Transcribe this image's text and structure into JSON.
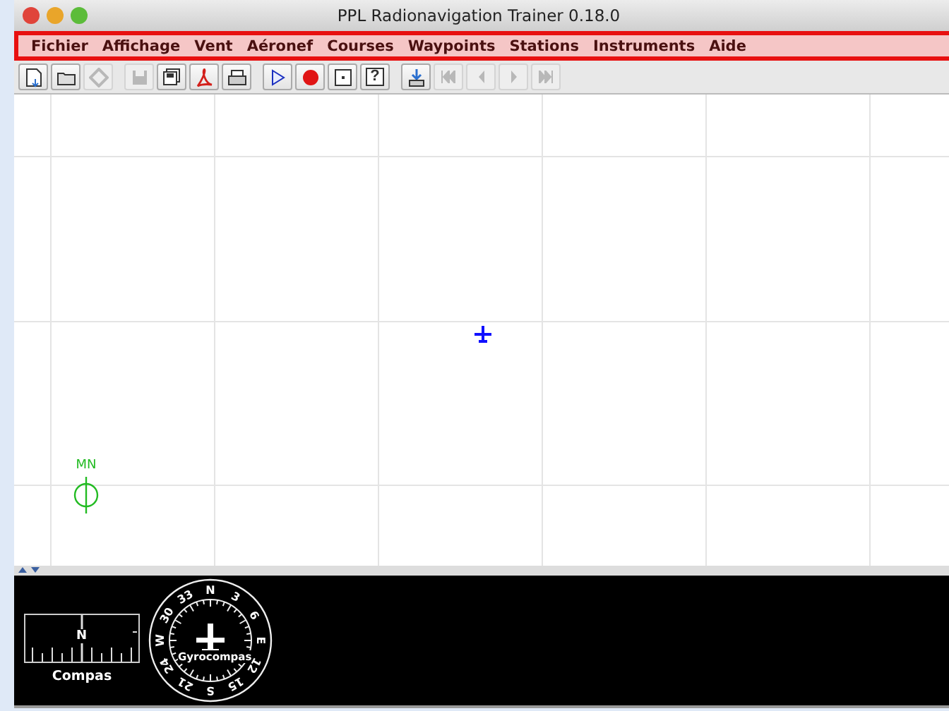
{
  "window": {
    "title": "PPL Radionavigation Trainer 0.18.0"
  },
  "menu_bar": {
    "highlighted": true,
    "items": [
      "Fichier",
      "Affichage",
      "Vent",
      "Aéronef",
      "Courses",
      "Waypoints",
      "Stations",
      "Instruments",
      "Aide"
    ]
  },
  "toolbar": [
    [
      {
        "kind": "new",
        "disabled": false
      },
      {
        "kind": "open",
        "disabled": false
      },
      {
        "kind": "diamond",
        "disabled": true
      }
    ],
    [
      {
        "kind": "save",
        "disabled": true
      },
      {
        "kind": "save-all",
        "disabled": false
      },
      {
        "kind": "pdf",
        "disabled": false
      },
      {
        "kind": "print",
        "disabled": false
      }
    ],
    [
      {
        "kind": "play",
        "disabled": false
      },
      {
        "kind": "record",
        "disabled": false
      },
      {
        "kind": "center",
        "disabled": false
      },
      {
        "kind": "help",
        "disabled": false,
        "glyph": "?"
      }
    ],
    [
      {
        "kind": "export",
        "disabled": false
      },
      {
        "kind": "first",
        "disabled": true
      },
      {
        "kind": "prev",
        "disabled": true
      },
      {
        "kind": "next",
        "disabled": true
      },
      {
        "kind": "last",
        "disabled": true
      }
    ]
  ],
  "map": {
    "north_label": "MN"
  },
  "instruments": [
    {
      "kind": "compass",
      "label": "Compas",
      "heading_label": "N"
    },
    {
      "kind": "gyrocompass",
      "label": "Gyrocompas",
      "dial_labels": [
        "N",
        "3",
        "6",
        "E",
        "12",
        "15",
        "S",
        "21",
        "24",
        "W",
        "30",
        "33"
      ]
    }
  ]
}
